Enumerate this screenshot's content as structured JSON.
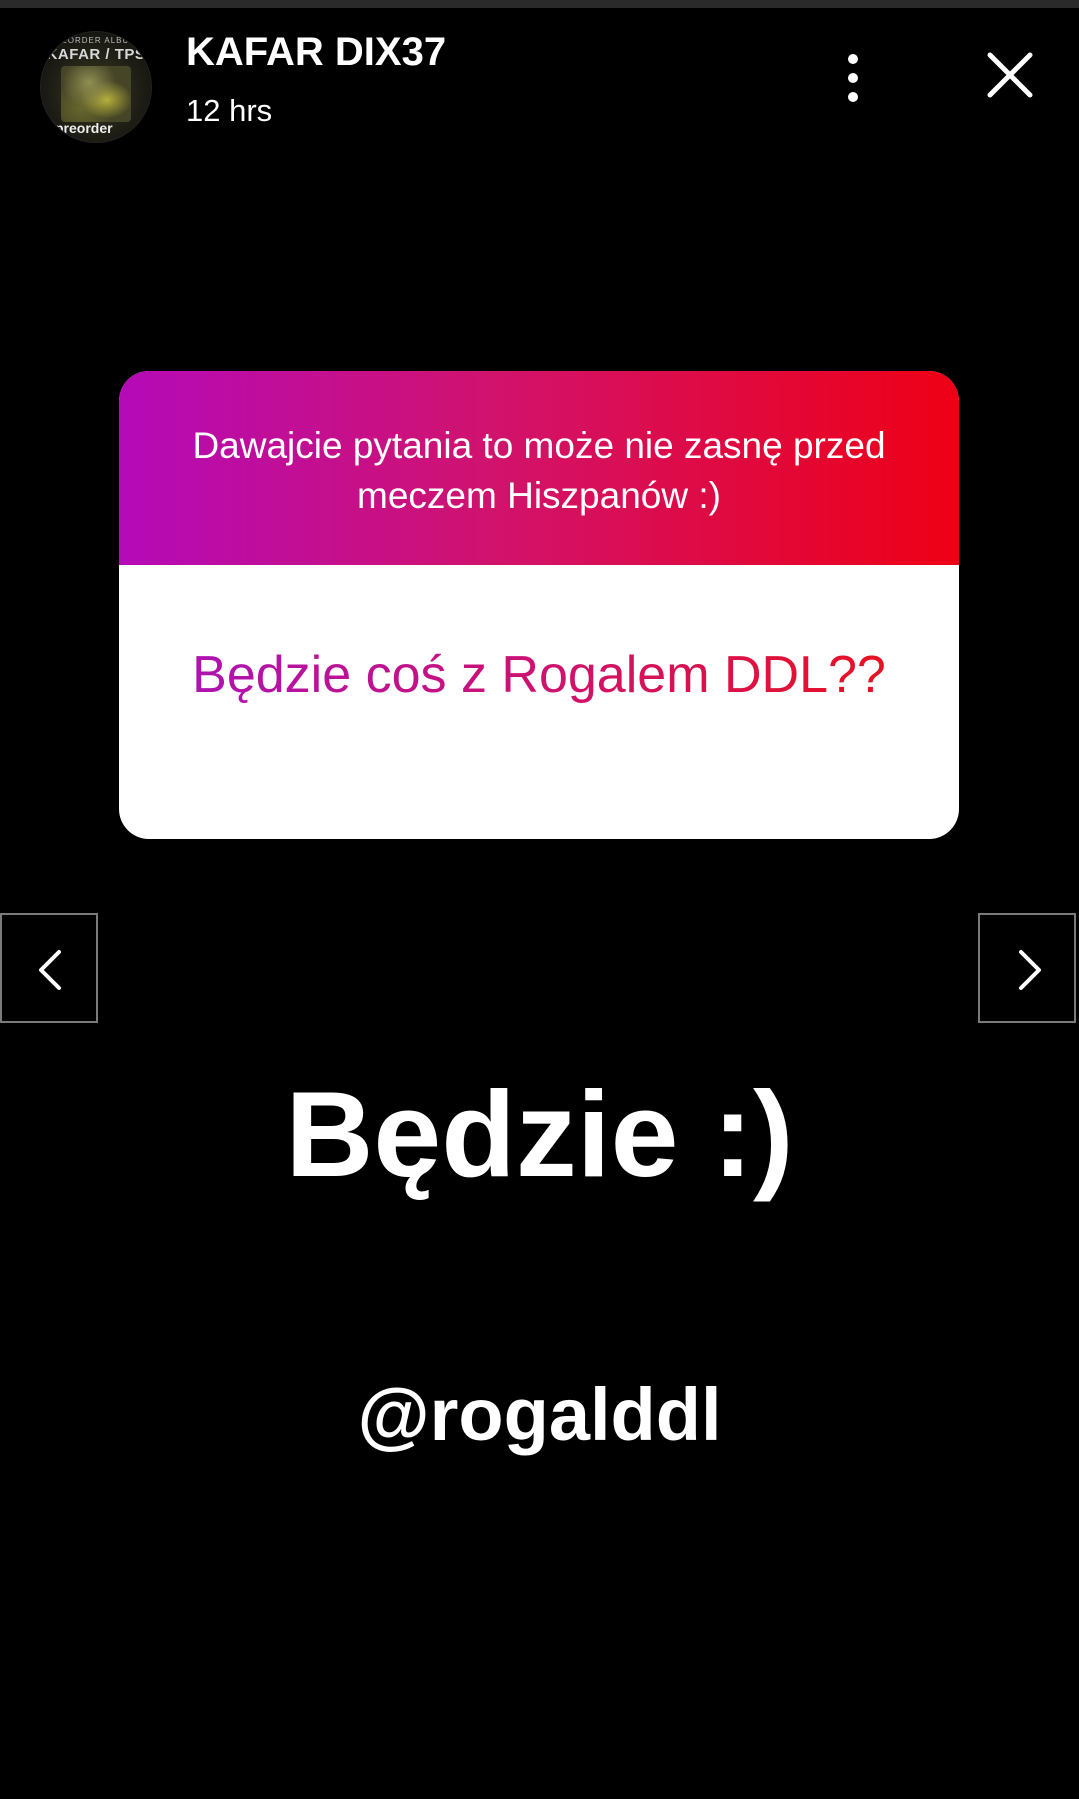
{
  "header": {
    "avatar": {
      "top_text": "PREORDER ALBUMU",
      "title_text": "KAFAR / TPS",
      "bottom_text": "preorder"
    },
    "author": "KAFAR DIX37",
    "time": "12 hrs",
    "more_icon": "more-vertical-icon",
    "close_icon": "close-icon"
  },
  "question_sticker": {
    "prompt": "Dawajcie pytania to może nie zasnę przed meczem Hiszpanów :)",
    "question": "Będzie coś z Rogalem DDL??",
    "gradient_colors": [
      "#b40ab8",
      "#d1136c",
      "#ee0015"
    ]
  },
  "navigation": {
    "prev_icon": "chevron-left-icon",
    "next_icon": "chevron-right-icon"
  },
  "story_text": {
    "answer": "Będzie :)",
    "mention": "@rogalddl"
  }
}
